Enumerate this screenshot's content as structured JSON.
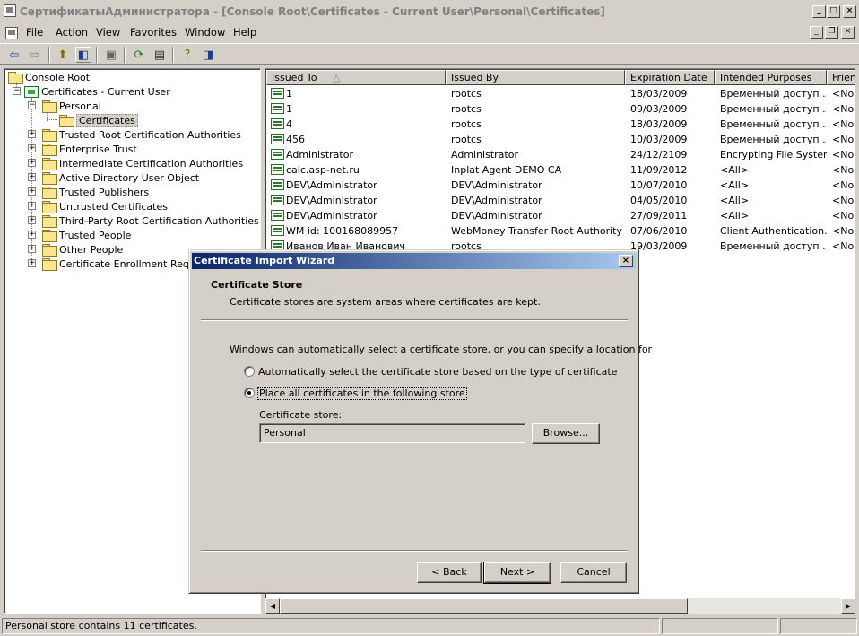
{
  "window": {
    "title": "СертификатыАдминистратора - [Console Root\\Certificates - Current User\\Personal\\Certificates]"
  },
  "menu": [
    "File",
    "Action",
    "View",
    "Favorites",
    "Window",
    "Help"
  ],
  "toolbar_icons": [
    "back-icon",
    "forward-icon",
    "up-folder-icon",
    "show-hide-tree-icon",
    "delete-icon",
    "refresh-icon",
    "export-list-icon",
    "help-icon",
    "new-window-icon"
  ],
  "tree": {
    "root": "Console Root",
    "store": "Certificates - Current User",
    "personal": "Personal",
    "certificates": "Certificates",
    "folders": [
      "Trusted Root Certification Authorities",
      "Enterprise Trust",
      "Intermediate Certification Authorities",
      "Active Directory User Object",
      "Trusted Publishers",
      "Untrusted Certificates",
      "Third-Party Root Certification Authorities",
      "Trusted People",
      "Other People",
      "Certificate Enrollment Reques"
    ]
  },
  "list": {
    "columns": [
      "Issued To",
      "Issued By",
      "Expiration Date",
      "Intended Purposes",
      "Friend"
    ],
    "sort_indicator": "△",
    "rows": [
      [
        "1",
        "rootcs",
        "18/03/2009",
        "Временный доступ ...",
        "<Non"
      ],
      [
        "1",
        "rootcs",
        "09/03/2009",
        "Временный доступ ...",
        "<Non"
      ],
      [
        "4",
        "rootcs",
        "18/03/2009",
        "Временный доступ ...",
        "<Non"
      ],
      [
        "456",
        "rootcs",
        "10/03/2009",
        "Временный доступ ...",
        "<Non"
      ],
      [
        "Administrator",
        "Administrator",
        "24/12/2109",
        "Encrypting File System",
        "<Non"
      ],
      [
        "calc.asp-net.ru",
        "Inplat Agent DEMO CA",
        "11/09/2012",
        "<All>",
        "<Non"
      ],
      [
        "DEV\\Administrator",
        "DEV\\Administrator",
        "10/07/2010",
        "<All>",
        "<Non"
      ],
      [
        "DEV\\Administrator",
        "DEV\\Administrator",
        "04/05/2010",
        "<All>",
        "<Non"
      ],
      [
        "DEV\\Administrator",
        "DEV\\Administrator",
        "27/09/2011",
        "<All>",
        "<Non"
      ],
      [
        "WM id: 100168089957",
        "WebMoney Transfer Root Authority",
        "07/06/2010",
        "Client Authentication...",
        "<Non"
      ],
      [
        "Иванов Иван Иванович",
        "rootcs",
        "19/03/2009",
        "Временный доступ ...",
        "<Non"
      ]
    ]
  },
  "status": "Personal store contains 11 certificates.",
  "wizard": {
    "title": "Certificate Import Wizard",
    "close": "×",
    "heading": "Certificate Store",
    "subheading": "Certificate stores are system areas where certificates are kept.",
    "intro": "Windows can automatically select a certificate store, or you can specify a location for",
    "option_auto": "Automatically select the certificate store based on the type of certificate",
    "option_place": "Place all certificates in the following store",
    "selected_option": "place",
    "store_label": "Certificate store:",
    "store_value": "Personal",
    "browse": "Browse...",
    "back": "< Back",
    "next": "Next >",
    "cancel": "Cancel"
  }
}
